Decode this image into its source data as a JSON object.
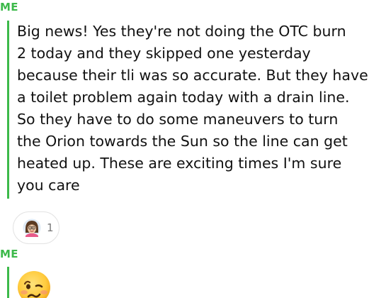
{
  "messages": [
    {
      "sender": "ME",
      "text": "Big news! Yes they're not doing the OTC burn\n2 today and they skipped one yesterday\nbecause their tli was so accurate. But they have\na toilet problem again today with a drain line.\nSo they have to do some maneuvers to turn\nthe Orion towards the Sun so the line can get\nheated up. These are exciting times I'm sure\nyou care",
      "reaction": {
        "icon": "bitmoji-avatar-icon",
        "count": "1"
      }
    },
    {
      "sender": "ME",
      "emoji": "woozy-face-icon"
    }
  ],
  "colors": {
    "accent": "#3cb94a",
    "text": "#111111",
    "count": "#777777"
  }
}
